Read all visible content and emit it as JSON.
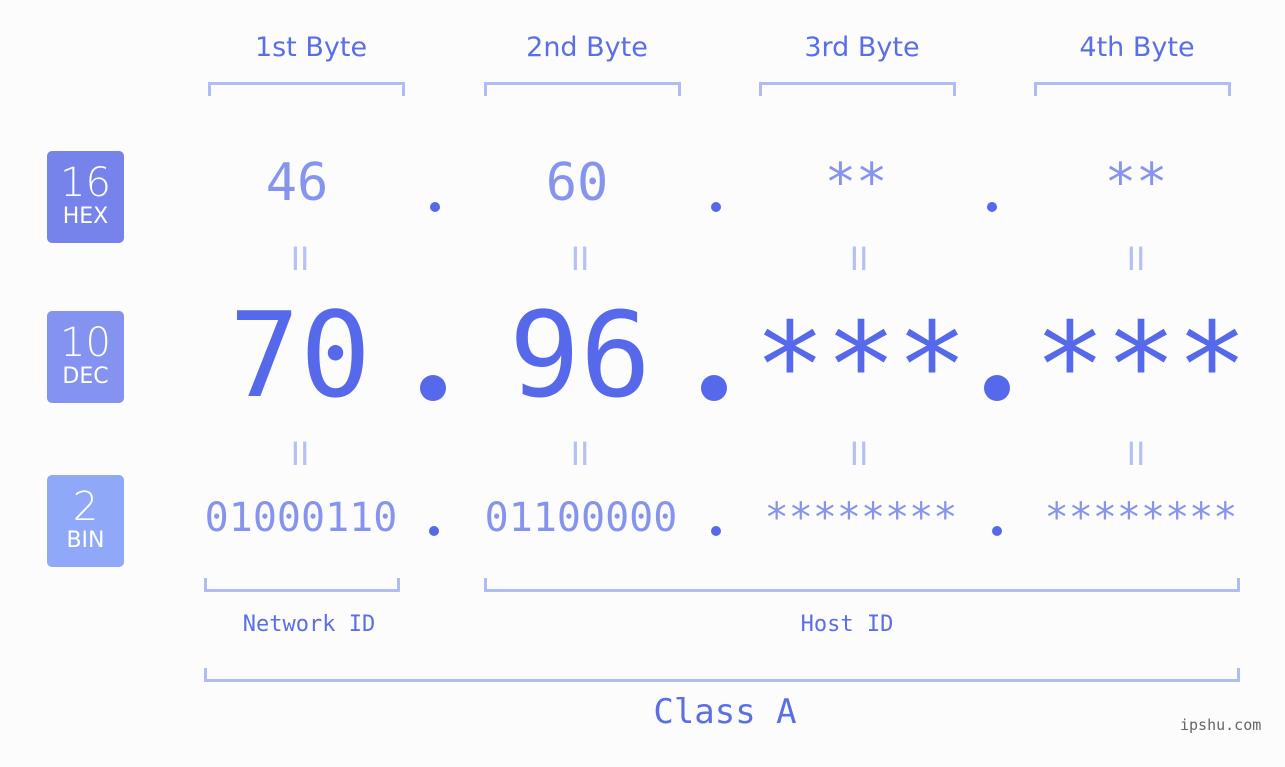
{
  "bytes": [
    {
      "header": "1st Byte",
      "hex": "46",
      "dec": "70",
      "bin": "01000110"
    },
    {
      "header": "2nd Byte",
      "hex": "60",
      "dec": "96",
      "bin": "01100000"
    },
    {
      "header": "3rd Byte",
      "hex": "**",
      "dec": "***",
      "bin": "********"
    },
    {
      "header": "4th Byte",
      "hex": "**",
      "dec": "***",
      "bin": "********"
    }
  ],
  "bases": [
    {
      "num": "16",
      "label": "HEX",
      "color": "#7583ea"
    },
    {
      "num": "10",
      "label": "DEC",
      "color": "#8593f0"
    },
    {
      "num": "2",
      "label": "BIN",
      "color": "#8fa8f8"
    }
  ],
  "equals_symbol": "II",
  "network_label": "Network ID",
  "host_label": "Host ID",
  "class_label": "Class A",
  "watermark": "ipshu.com",
  "colors": {
    "accent": "#5669ea",
    "light": "#8694ee",
    "bracket": "#b1bcf6"
  }
}
